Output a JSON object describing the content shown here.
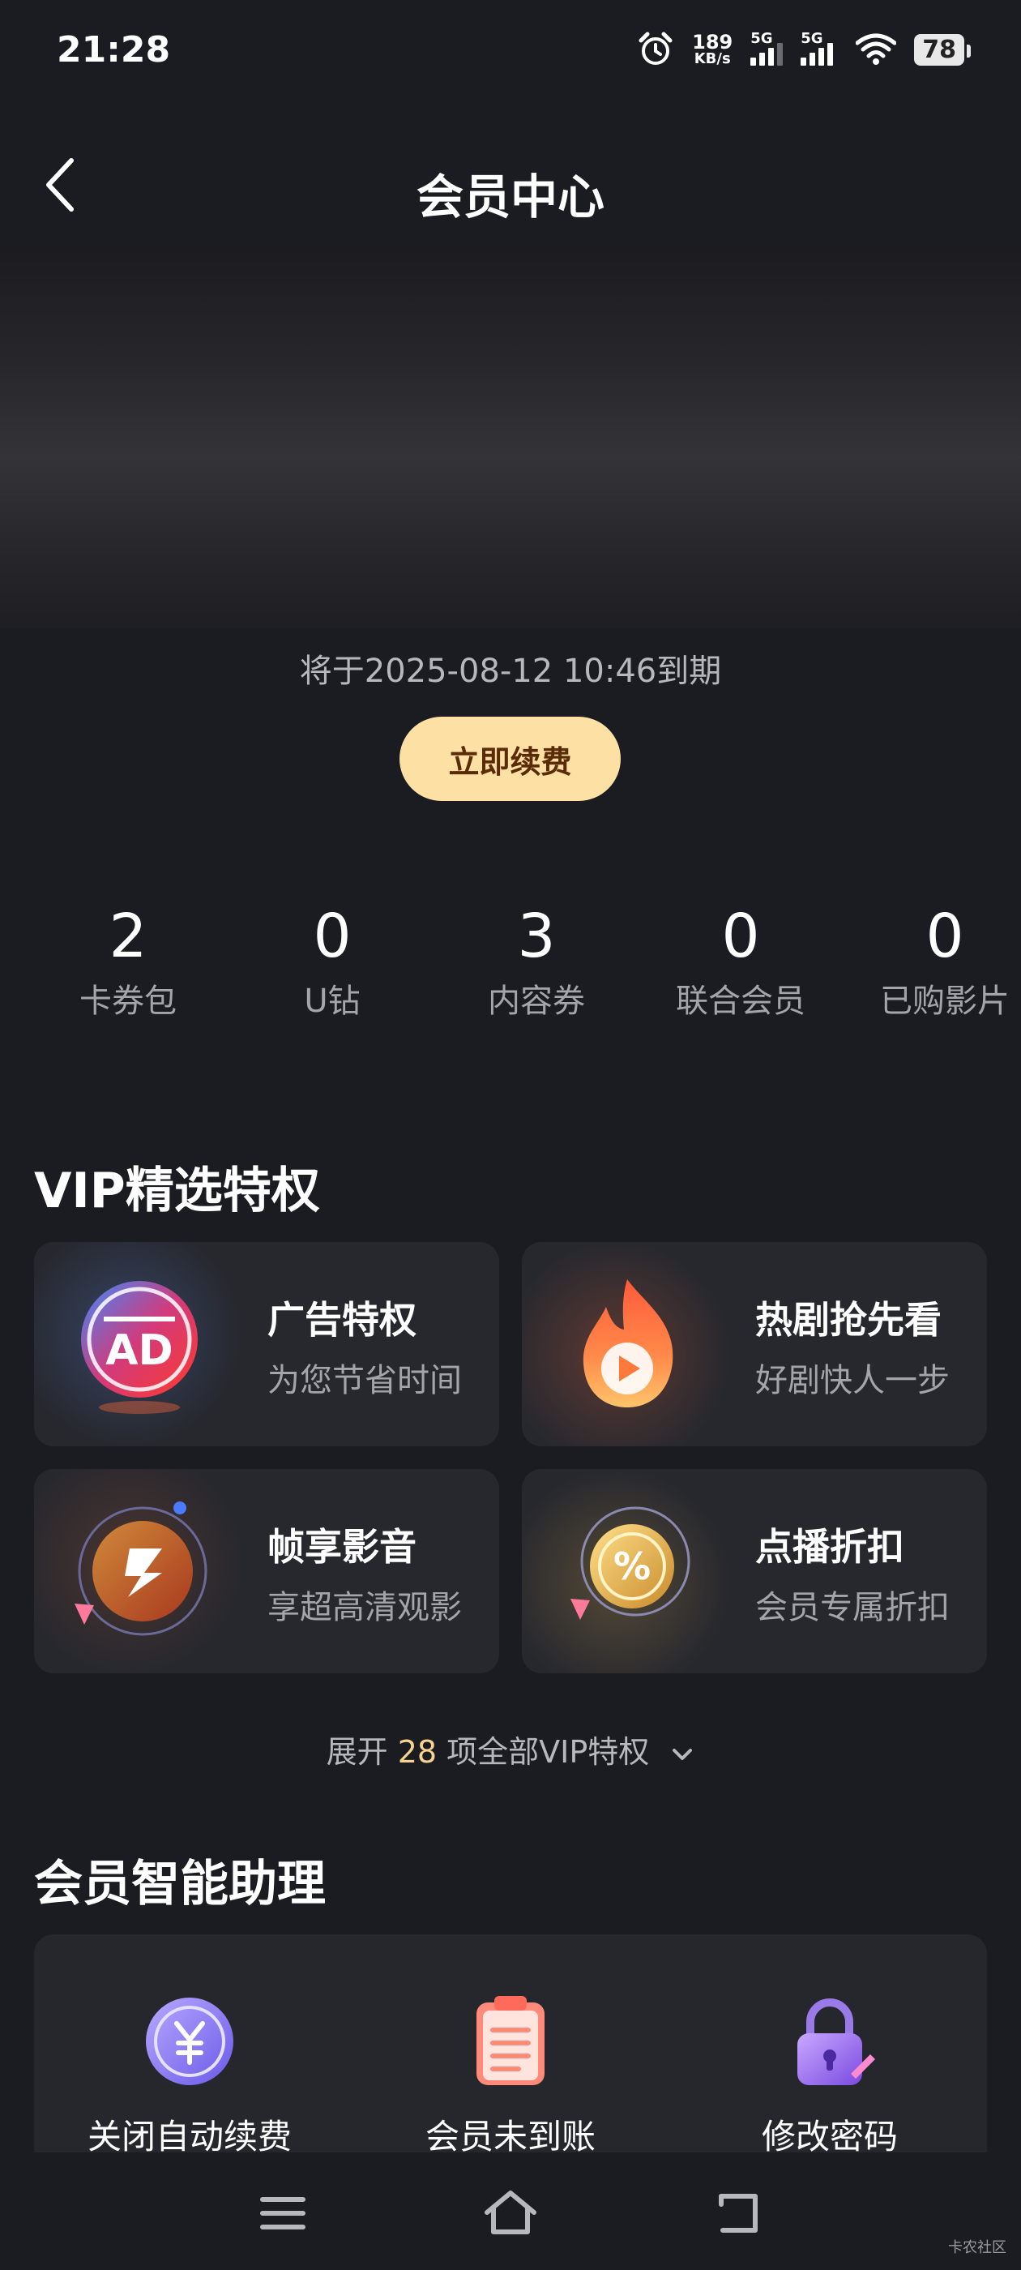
{
  "status_bar": {
    "time": "21:28",
    "net_speed_value": "189",
    "net_speed_unit": "KB/s",
    "sim1_label": "5G",
    "sim2_label": "5G",
    "battery": "78",
    "icons": [
      "alarm-icon",
      "signal-icon",
      "signal-icon",
      "wifi-icon",
      "battery-icon"
    ]
  },
  "header": {
    "title": "会员中心",
    "back_icon": "chevron-left-icon"
  },
  "membership": {
    "expire_text": "将于2025-08-12 10:46到期",
    "renew_label": "立即续费"
  },
  "stats": [
    {
      "value": "2",
      "label": "卡券包"
    },
    {
      "value": "0",
      "label": "U钻"
    },
    {
      "value": "3",
      "label": "内容券"
    },
    {
      "value": "0",
      "label": "联合会员"
    },
    {
      "value": "0",
      "label": "已购影片"
    }
  ],
  "vip": {
    "section_title": "VIP精选特权",
    "cards": [
      {
        "title": "广告特权",
        "subtitle": "为您节省时间",
        "icon": "ad-icon"
      },
      {
        "title": "热剧抢先看",
        "subtitle": "好剧快人一步",
        "icon": "flame-play-icon"
      },
      {
        "title": "帧享影音",
        "subtitle": "享超高清观影",
        "icon": "frame-audio-icon"
      },
      {
        "title": "点播折扣",
        "subtitle": "会员专属折扣",
        "icon": "discount-coin-icon"
      }
    ],
    "expand_prefix": "展开 ",
    "expand_count": "28",
    "expand_suffix": " 项全部VIP特权"
  },
  "assistant": {
    "section_title": "会员智能助理",
    "items": [
      {
        "label": "关闭自动续费",
        "icon": "yuan-coin-icon"
      },
      {
        "label": "会员未到账",
        "icon": "clipboard-icon"
      },
      {
        "label": "修改密码",
        "icon": "lock-icon"
      }
    ]
  },
  "navbar": {
    "icons": [
      "menu-icon",
      "home-icon",
      "back-icon"
    ]
  },
  "watermark": "卡农社区",
  "colors": {
    "background": "#1b1c21",
    "card": "#27282e",
    "renew_button": "#fde0a4",
    "renew_text": "#5b2a07",
    "accent_count": "#f6d48f"
  }
}
